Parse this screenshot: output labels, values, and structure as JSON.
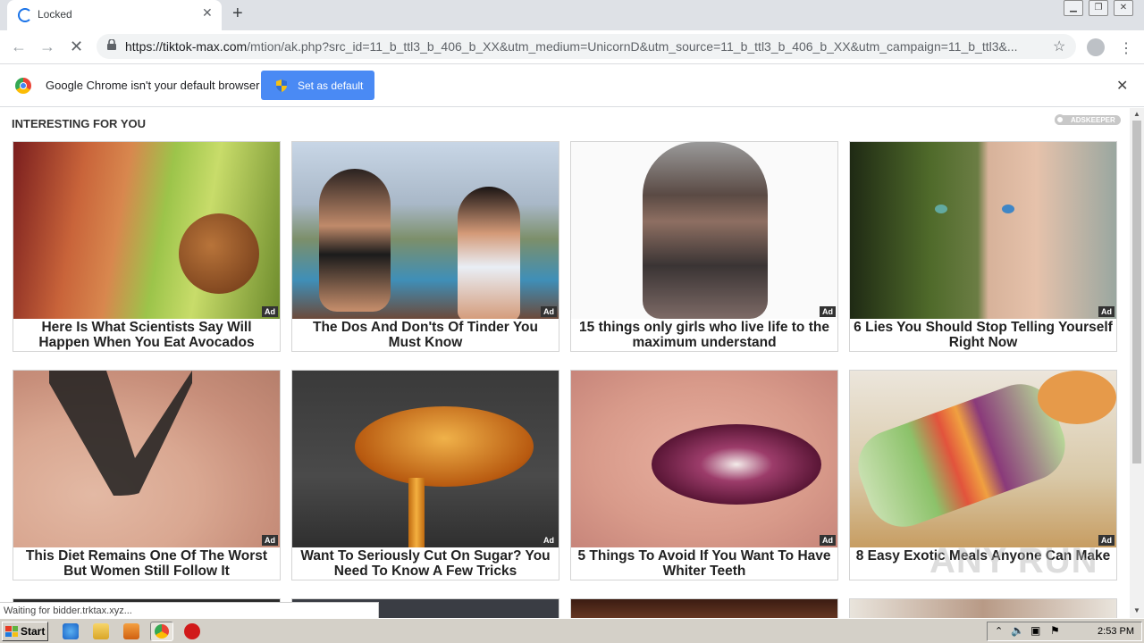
{
  "browser": {
    "tab_title": "Locked",
    "new_tab": "+",
    "url_host": "https://tiktok-max.com",
    "url_rest": "/mtion/ak.php?src_id=11_b_ttl3_b_406_b_XX&utm_medium=UnicornD&utm_source=11_b_ttl3_b_406_b_XX&utm_campaign=11_b_ttl3&..."
  },
  "infobar": {
    "message": "Google Chrome isn't your default browser",
    "button": "Set as default"
  },
  "section": {
    "title": "INTERESTING FOR YOU",
    "sponsor": "ADSKEEPER"
  },
  "cards": [
    {
      "caption": "Here Is What Scientists Say Will Happen When You Eat Avocados",
      "badge": "Ad"
    },
    {
      "caption": "The Dos And Don'ts Of Tinder You Must Know",
      "badge": "Ad"
    },
    {
      "caption": "15 things only girls who live life to the maximum understand",
      "badge": "Ad"
    },
    {
      "caption": "6 Lies You Should Stop Telling Yourself Right Now",
      "badge": "Ad"
    },
    {
      "caption": "This Diet Remains One Of The Worst But Women Still Follow It",
      "badge": "Ad"
    },
    {
      "caption": "Want To Seriously Cut On Sugar? You Need To Know A Few Tricks",
      "badge": "Ad"
    },
    {
      "caption": "5 Things To Avoid If You Want To Have Whiter Teeth",
      "badge": "Ad"
    },
    {
      "caption": "8 Easy Exotic Meals Anyone Can Make",
      "badge": "Ad"
    }
  ],
  "status": "Waiting for bidder.trktax.xyz...",
  "taskbar": {
    "start": "Start",
    "clock": "2:53 PM"
  },
  "watermark": "ANY RUN"
}
